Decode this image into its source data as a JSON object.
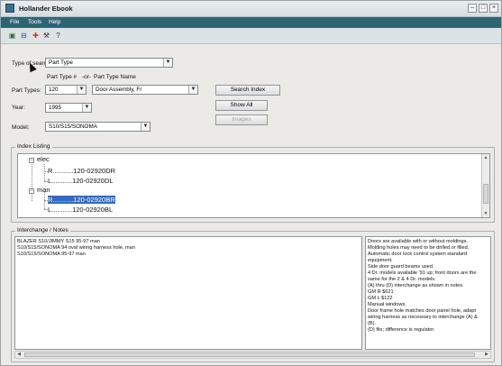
{
  "window": {
    "title": "Hollander Ebook"
  },
  "menu": [
    "File",
    "Tools",
    "Help"
  ],
  "toolbar_icons": [
    "print-icon",
    "save-icon",
    "color-icon",
    "tools-icon",
    "help-icon"
  ],
  "form": {
    "type_of_search_label": "Type of search:",
    "type_of_search_value": "Part Type",
    "part_type_num_label": "Part Type #",
    "or_label": "-or-",
    "part_type_name_label": "Part Type Name",
    "part_types_label": "Part Types:",
    "part_type_value": "120",
    "part_name_value": "Door Assembly, Fr",
    "year_label": "Year:",
    "year_value": "1995",
    "model_label": "Model:",
    "model_value": "S10/S15/SONOMA"
  },
  "buttons": {
    "search_index": "Search Index",
    "show_all": "Show All",
    "images": "Images"
  },
  "index_listing": {
    "title": "Index Listing",
    "groups": [
      {
        "name": "elec",
        "items": [
          "R...........120-02920DR",
          "L...........120-02920DL"
        ]
      },
      {
        "name": "man",
        "items": [
          "R...........120-02920BR",
          "L...........120-02920BL"
        ]
      }
    ]
  },
  "notes": {
    "title": "Interchange / Notes",
    "left_lines": [
      "BLAZER S10/JIMMY S15 95-97 man",
      "S10/S15/SONOMA 94 oval wiring harness hole, man",
      "S10/S15/SONOMA 95-97 man"
    ],
    "right_lines": [
      "Doors are available with or without moldings.",
      "Molding holes may need to be drilled or filled.",
      "Automatic door lock control system standard",
      "equipment.",
      "Side door guard beams used.",
      "4 Dr. models available '91 up; front doors are the",
      "same for the 2 & 4 Dr. models.",
      "(A) thru (D) interchange as shown in notes.",
      "GM R       $621",
      "GM L       $122",
      "Manual windows.",
      "Door frame hole matches door panel hole, adapt",
      "wiring harness as necessary to interchange (A) &",
      "(B).",
      "(D) fits; difference is regulator."
    ]
  }
}
